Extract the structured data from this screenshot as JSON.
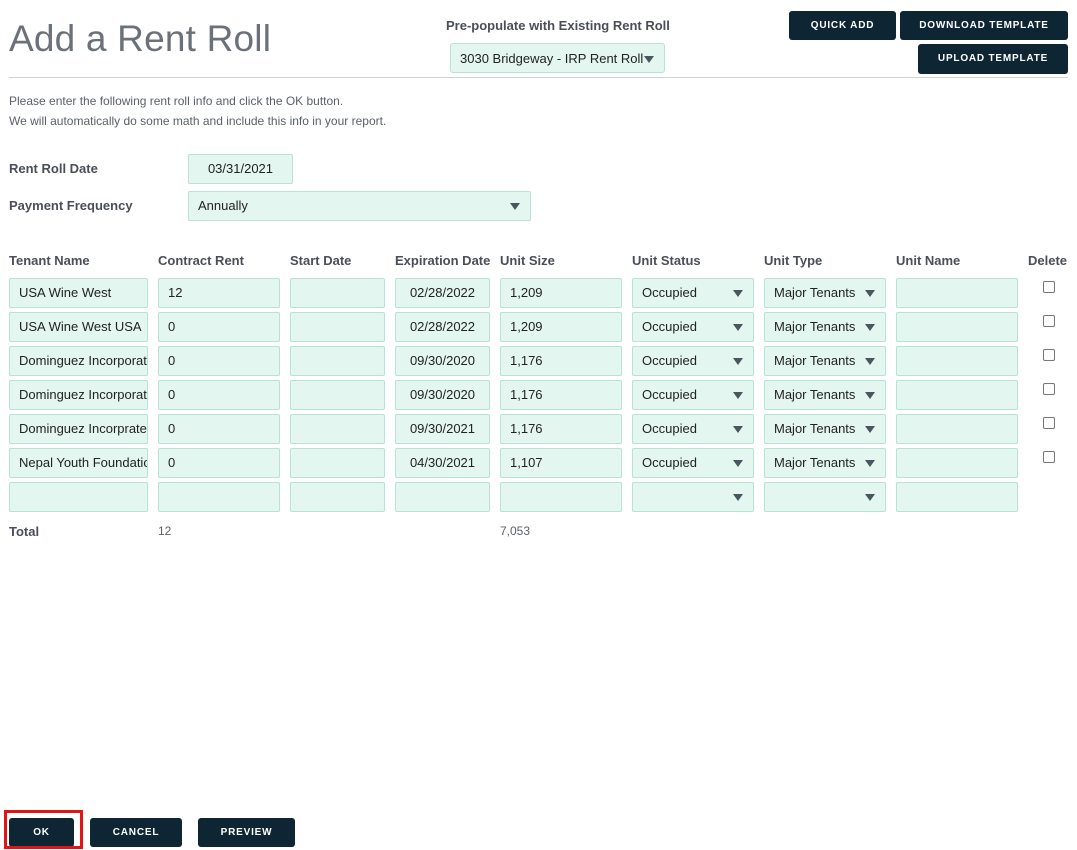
{
  "page_title": "Add a Rent Roll",
  "prepopulate": {
    "label": "Pre-populate with Existing Rent Roll",
    "selected": "3030 Bridgeway - IRP Rent Roll"
  },
  "toolbar": {
    "quick_add": "QUICK ADD",
    "download_template": "DOWNLOAD TEMPLATE",
    "upload_template": "UPLOAD TEMPLATE"
  },
  "intro": {
    "line1": "Please enter the following rent roll info and click the OK button.",
    "line2": "We will automatically do some math and include this info in your report."
  },
  "form": {
    "rent_roll_date_label": "Rent Roll Date",
    "rent_roll_date": "03/31/2021",
    "payment_frequency_label": "Payment Frequency",
    "payment_frequency": "Annually"
  },
  "table": {
    "headers": [
      "Tenant Name",
      "Contract Rent",
      "Start Date",
      "Expiration Date",
      "Unit Size",
      "Unit Status",
      "Unit Type",
      "Unit Name",
      "Delete"
    ],
    "rows": [
      {
        "tenant": "USA Wine West",
        "rent": "12",
        "start": "",
        "expiration": "02/28/2022",
        "size": "1,209",
        "status": "Occupied",
        "type": "Major Tenants",
        "unit_name": ""
      },
      {
        "tenant": "USA Wine West USA",
        "rent": "0",
        "start": "",
        "expiration": "02/28/2022",
        "size": "1,209",
        "status": "Occupied",
        "type": "Major Tenants",
        "unit_name": ""
      },
      {
        "tenant": "Dominguez Incorporated",
        "rent": "0",
        "start": "",
        "expiration": "09/30/2020",
        "size": "1,176",
        "status": "Occupied",
        "type": "Major Tenants",
        "unit_name": ""
      },
      {
        "tenant": "Dominguez Incorporated",
        "rent": "0",
        "start": "",
        "expiration": "09/30/2020",
        "size": "1,176",
        "status": "Occupied",
        "type": "Major Tenants",
        "unit_name": ""
      },
      {
        "tenant": "Dominguez Incorprated",
        "rent": "0",
        "start": "",
        "expiration": "09/30/2021",
        "size": "1,176",
        "status": "Occupied",
        "type": "Major Tenants",
        "unit_name": ""
      },
      {
        "tenant": "Nepal Youth Foundation",
        "rent": "0",
        "start": "",
        "expiration": "04/30/2021",
        "size": "1,107",
        "status": "Occupied",
        "type": "Major Tenants",
        "unit_name": ""
      },
      {
        "tenant": "",
        "rent": "",
        "start": "",
        "expiration": "",
        "size": "",
        "status": "",
        "type": "",
        "unit_name": ""
      }
    ],
    "total_label": "Total",
    "total_rent": "12",
    "total_size": "7,053"
  },
  "footer": {
    "ok": "OK",
    "cancel": "CANCEL",
    "preview": "PREVIEW"
  },
  "colors": {
    "input_bg": "#e3f6ef",
    "input_border": "#b6e3d2",
    "button_bg": "#0e2533",
    "highlight": "#e01515"
  }
}
